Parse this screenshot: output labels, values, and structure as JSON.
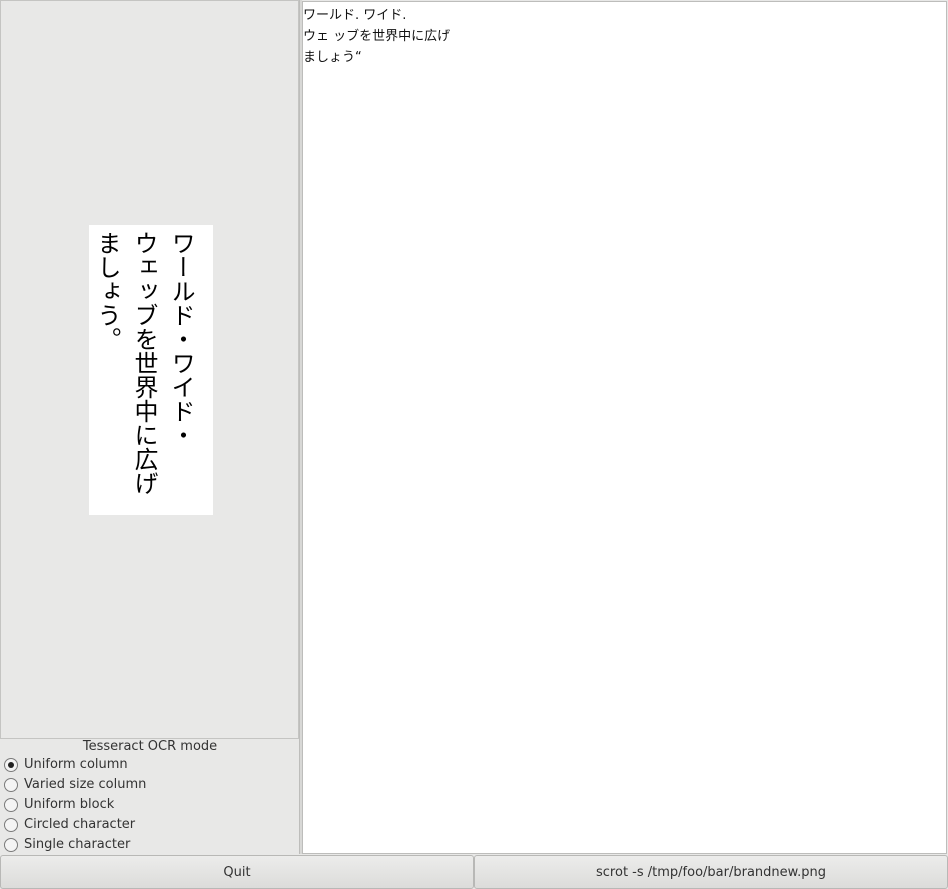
{
  "image_panel": {
    "vertical_lines": [
      "ワールド・ワイド・",
      "ウェッブを世界中に広げ",
      "ましょう。"
    ]
  },
  "ocr_mode": {
    "title": "Tesseract OCR mode",
    "options": [
      {
        "label": "Uniform column",
        "selected": true
      },
      {
        "label": "Varied size column",
        "selected": false
      },
      {
        "label": "Uniform block",
        "selected": false
      },
      {
        "label": "Circled character",
        "selected": false
      },
      {
        "label": "Single character",
        "selected": false
      }
    ]
  },
  "result": {
    "lines": [
      "ワールド. ワイド.",
      "ウェ ッブを世界中に広げ",
      "ましょう“"
    ]
  },
  "buttons": {
    "quit_label": "Quit",
    "scrot_label": "scrot -s /tmp/foo/bar/brandnew.png"
  }
}
